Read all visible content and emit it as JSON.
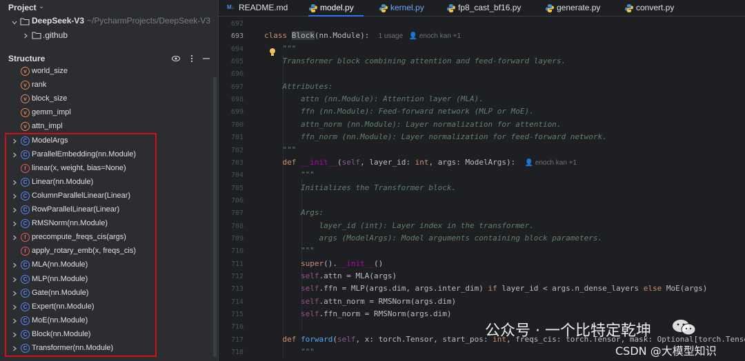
{
  "project": {
    "title": "Project",
    "repo_name": "DeepSeek-V3",
    "repo_path": "~/PycharmProjects/DeepSeek-V3",
    "subfolder": ".github"
  },
  "structure": {
    "title": "Structure",
    "items": [
      {
        "label": "world_size",
        "kind": "var",
        "expandable": false
      },
      {
        "label": "rank",
        "kind": "var",
        "expandable": false
      },
      {
        "label": "block_size",
        "kind": "var",
        "expandable": false
      },
      {
        "label": "gemm_impl",
        "kind": "var",
        "expandable": false
      },
      {
        "label": "attn_impl",
        "kind": "var",
        "expandable": false
      },
      {
        "label": "ModelArgs",
        "kind": "class",
        "expandable": true
      },
      {
        "label": "ParallelEmbedding(nn.Module)",
        "kind": "class",
        "expandable": true
      },
      {
        "label": "linear(x, weight, bias=None)",
        "kind": "func",
        "expandable": false
      },
      {
        "label": "Linear(nn.Module)",
        "kind": "class",
        "expandable": true
      },
      {
        "label": "ColumnParallelLinear(Linear)",
        "kind": "class",
        "expandable": true
      },
      {
        "label": "RowParallelLinear(Linear)",
        "kind": "class",
        "expandable": true
      },
      {
        "label": "RMSNorm(nn.Module)",
        "kind": "class",
        "expandable": true
      },
      {
        "label": "precompute_freqs_cis(args)",
        "kind": "func",
        "expandable": true
      },
      {
        "label": "apply_rotary_emb(x, freqs_cis)",
        "kind": "func",
        "expandable": false
      },
      {
        "label": "MLA(nn.Module)",
        "kind": "class",
        "expandable": true
      },
      {
        "label": "MLP(nn.Module)",
        "kind": "class",
        "expandable": true
      },
      {
        "label": "Gate(nn.Module)",
        "kind": "class",
        "expandable": true
      },
      {
        "label": "Expert(nn.Module)",
        "kind": "class",
        "expandable": true
      },
      {
        "label": "MoE(nn.Module)",
        "kind": "class",
        "expandable": true
      },
      {
        "label": "Block(nn.Module)",
        "kind": "class",
        "expandable": true
      },
      {
        "label": "Transformer(nn.Module)",
        "kind": "class",
        "expandable": true
      }
    ]
  },
  "tabs": [
    {
      "label": "README.md",
      "icon": "markdown-icon",
      "active": false
    },
    {
      "label": "model.py",
      "icon": "python-icon",
      "active": true
    },
    {
      "label": "kernel.py",
      "icon": "python-icon",
      "active": false
    },
    {
      "label": "fp8_cast_bf16.py",
      "icon": "python-icon",
      "active": false
    },
    {
      "label": "generate.py",
      "icon": "python-icon",
      "active": false
    },
    {
      "label": "convert.py",
      "icon": "python-icon",
      "active": false
    }
  ],
  "editor": {
    "lines": [
      {
        "n": "692",
        "html": ""
      },
      {
        "n": "693",
        "html": "<span class=\"kw\">class</span> <span style=\"background:#373b39\">Block</span>(nn.Module):  <span class=\"hint\">1 usage   ⁠&#128100; enoch kan +1</span>"
      },
      {
        "n": "694",
        "html": "    <span class=\"doc\">\"\"\"</span>"
      },
      {
        "n": "695",
        "html": "    <span class=\"doc\">Transformer block combining attention and feed-forward layers.</span>"
      },
      {
        "n": "696",
        "html": ""
      },
      {
        "n": "697",
        "html": "    <span class=\"doc\">Attributes:</span>"
      },
      {
        "n": "698",
        "html": "        <span class=\"doc\">attn (nn.Module): Attention layer (MLA).</span>"
      },
      {
        "n": "699",
        "html": "        <span class=\"doc\">ffn (nn.Module): Feed-forward network (MLP or MoE).</span>"
      },
      {
        "n": "700",
        "html": "        <span class=\"doc\">attn_norm (nn.Module): Layer normalization for attention.</span>"
      },
      {
        "n": "701",
        "html": "        <span class=\"doc\">ffn_norm (nn.Module): Layer normalization for feed-forward network.</span>"
      },
      {
        "n": "702",
        "html": "    <span class=\"doc\">\"\"\"</span>"
      },
      {
        "n": "703",
        "html": "    <span class=\"kw\">def</span> <span class=\"dunder\">__init__</span>(<span class=\"self\">self</span>, layer_id: <span class=\"kw\">int</span>, args: ModelArgs):  <span class=\"hint\">&#128100; enoch kan +1</span>"
      },
      {
        "n": "704",
        "html": "        <span class=\"doc\">\"\"\"</span>"
      },
      {
        "n": "705",
        "html": "        <span class=\"doc\">Initializes the Transformer block.</span>"
      },
      {
        "n": "706",
        "html": ""
      },
      {
        "n": "707",
        "html": "        <span class=\"doc\">Args:</span>"
      },
      {
        "n": "708",
        "html": "            <span class=\"doc\">layer_id (int): Layer index in the transformer.</span>"
      },
      {
        "n": "709",
        "html": "            <span class=\"doc\">args (ModelArgs): Model arguments containing block parameters.</span>"
      },
      {
        "n": "710",
        "html": "        <span class=\"doc\">\"\"\"</span>"
      },
      {
        "n": "711",
        "html": "        <span class=\"kw\">super</span>().<span class=\"dunder\">__init__</span>()"
      },
      {
        "n": "712",
        "html": "        <span class=\"self\">self</span>.attn = MLA(args)"
      },
      {
        "n": "713",
        "html": "        <span class=\"self\">self</span>.ffn = MLP(args.dim, args.inter_dim) <span class=\"kw\">if</span> layer_id &lt; args.n_dense_layers <span class=\"kw\">else</span> MoE(args)"
      },
      {
        "n": "714",
        "html": "        <span class=\"self\">self</span>.attn_norm = RMSNorm(args.dim)"
      },
      {
        "n": "715",
        "html": "        <span class=\"self\">self</span>.ffn_norm = RMSNorm(args.dim)"
      },
      {
        "n": "716",
        "html": ""
      },
      {
        "n": "717",
        "html": "    <span class=\"kw\">def</span> <span class=\"fn\">forward</span>(<span class=\"self\">self</span>, x: torch.Tensor, start_pos: <span class=\"kw\">int</span>, freqs_cis: torch.Tensor, mask: Optional[torch.Tensor"
      },
      {
        "n": "718",
        "html": "        <span class=\"doc\">\"\"\"</span>"
      }
    ]
  },
  "watermarks": {
    "wechat": "公众号 · 一个比特定乾坤",
    "csdn": "CSDN @大模型知识"
  }
}
